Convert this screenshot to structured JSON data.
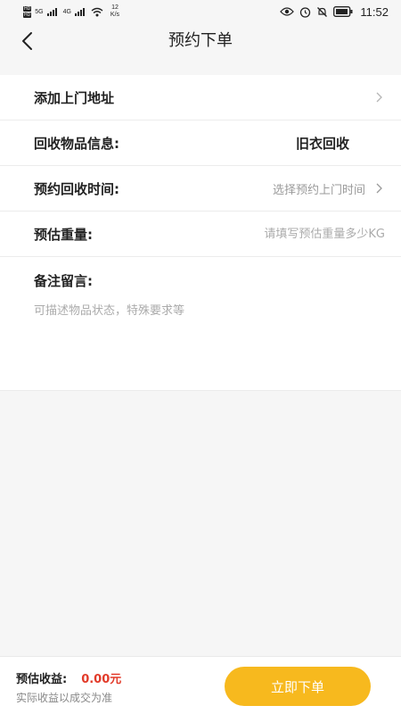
{
  "status_bar": {
    "hd1": "HD",
    "hd2": "HD",
    "net1": "5G",
    "net2": "4G",
    "speed_value": "12",
    "speed_unit": "K/s",
    "time": "11:52"
  },
  "nav": {
    "title": "预约下单"
  },
  "form": {
    "address": {
      "label": "添加上门地址"
    },
    "item_info": {
      "label": "回收物品信息:",
      "value": "旧衣回收"
    },
    "time": {
      "label": "预约回收时间:",
      "placeholder": "选择预约上门时间"
    },
    "weight": {
      "label": "预估重量:",
      "placeholder": "请填写预估重量多少KG"
    },
    "remark": {
      "label": "备注留言:",
      "placeholder": "可描述物品状态，特殊要求等"
    }
  },
  "bottom": {
    "earn_label": "预估收益:",
    "earn_value": "0.00元",
    "earn_note": "实际收益以成交为准",
    "submit_label": "立即下单"
  },
  "colors": {
    "accent": "#f7b91e",
    "price": "#e23b2a",
    "background": "#f6f6f6"
  }
}
